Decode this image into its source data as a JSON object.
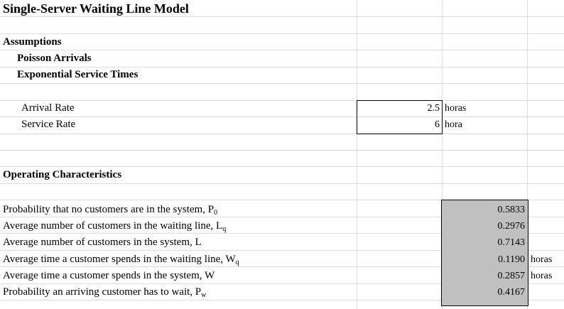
{
  "title": "Single-Server Waiting Line Model",
  "assumptions": {
    "heading": "Assumptions",
    "items": [
      "Poisson Arrivals",
      "Exponential Service Times"
    ]
  },
  "inputs": [
    {
      "label": "Arrival Rate",
      "value": "2.5",
      "unit": "horas"
    },
    {
      "label": "Service Rate",
      "value": "6",
      "unit": "hora"
    }
  ],
  "operating": {
    "heading": "Operating Characteristics",
    "rows": [
      {
        "label": "Probability that no customers are in the system, P",
        "sub": "0",
        "value": "0.5833",
        "unit": ""
      },
      {
        "label": "Average number of customers in the waiting line, L",
        "sub": "q",
        "value": "0.2976",
        "unit": ""
      },
      {
        "label": "Average number of customers in the system, L",
        "sub": "",
        "value": "0.7143",
        "unit": ""
      },
      {
        "label": "Average time a customer spends in the waiting line, W",
        "sub": "q",
        "value": "0.1190",
        "unit": "horas"
      },
      {
        "label": "Average time a customer spends in the system, W",
        "sub": "",
        "value": "0.2857",
        "unit": "horas"
      },
      {
        "label": "Probability an arriving customer has to wait, P",
        "sub": "w",
        "value": "0.4167",
        "unit": ""
      }
    ]
  }
}
